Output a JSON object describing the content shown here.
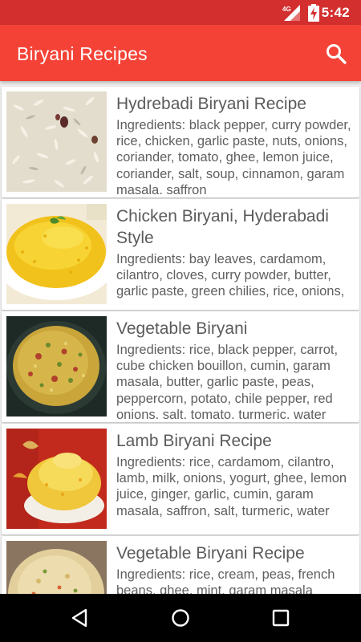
{
  "status_bar": {
    "network": "4G",
    "time": "5:42"
  },
  "app_bar": {
    "title": "Biryani Recipes",
    "search_icon": "search-icon"
  },
  "recipes": [
    {
      "title": "Hydrebadi Biryani Recipe",
      "ingredients": "Ingredients: black pepper, curry powder, rice, chicken, garlic paste, nuts, onions, coriander, tomato, ghee, lemon juice, coriander, salt, soup, cinnamon, garam masala, saffron"
    },
    {
      "title": "Chicken Biryani, Hyderabadi Style",
      "ingredients": "Ingredients: bay leaves, cardamom, cilantro, cloves, curry powder, butter, garlic paste, green chilies, rice, onions,"
    },
    {
      "title": "Vegetable Biryani",
      "ingredients": "Ingredients: rice, black pepper, carrot, cube chicken bouillon, cumin, garam masala, butter, garlic paste, peas, peppercorn, potato, chile pepper, red onions, salt, tomato, turmeric, water"
    },
    {
      "title": "Lamb Biryani Recipe",
      "ingredients": "Ingredients: rice, cardamom, cilantro, lamb, milk, onions, yogurt, ghee, lemon juice, ginger, garlic, cumin, garam masala, saffron, salt, turmeric, water"
    },
    {
      "title": "Vegetable Biryani Recipe",
      "ingredients": "Ingredients: rice, cream, peas, french beans, ghee, mint, garam masala"
    }
  ],
  "nav_bar": {
    "back_icon": "back-triangle-icon",
    "home_icon": "home-circle-icon",
    "recents_icon": "recents-square-icon"
  },
  "colors": {
    "status_bar": "#d32f2f",
    "app_bar": "#f44336",
    "background": "#eeeeee",
    "card": "#ffffff",
    "text": "#5f5f5f"
  }
}
